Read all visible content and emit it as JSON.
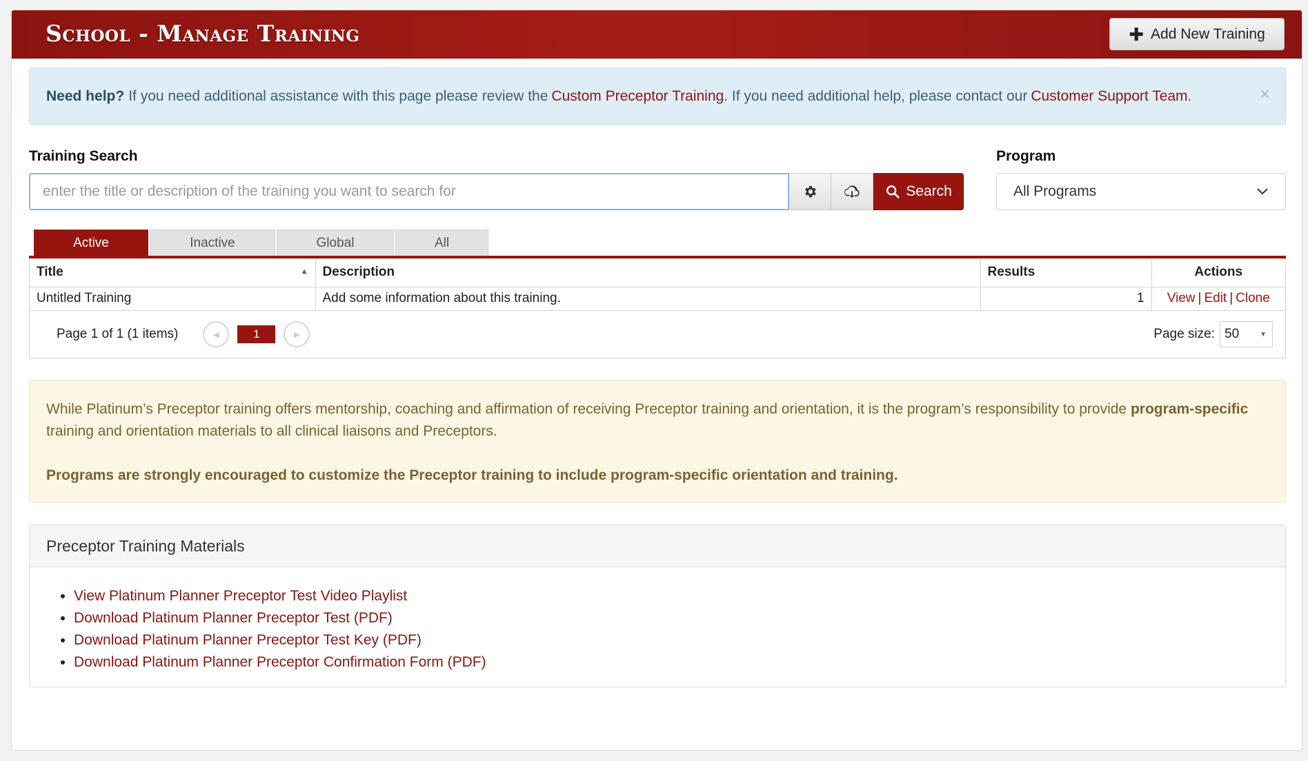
{
  "header": {
    "title": "School - Manage Training",
    "add_button": "Add New Training"
  },
  "help": {
    "lead": "Need help?",
    "text1": "If you need additional assistance with this page please review the",
    "link1": "Custom Preceptor Training",
    "text2": ". If you need additional help, please contact our",
    "link2": "Customer Support Team",
    "text3": ".",
    "close": "×"
  },
  "search": {
    "label": "Training Search",
    "placeholder": "enter the title or description of the training you want to search for",
    "button": "Search"
  },
  "program": {
    "label": "Program",
    "selected": "All Programs"
  },
  "tabs": [
    "Active",
    "Inactive",
    "Global",
    "All"
  ],
  "grid": {
    "columns": [
      "Title",
      "Description",
      "Results",
      "Actions"
    ],
    "rows": [
      {
        "title": "Untitled Training",
        "description": "Add some information about this training.",
        "results": "1"
      }
    ],
    "actions": [
      "View",
      "Edit",
      "Clone"
    ],
    "pager_info": "Page 1 of 1 (1 items)",
    "current_page": "1",
    "page_size_label": "Page size:",
    "page_size": "50"
  },
  "notice": {
    "text1": "While Platinum’s Preceptor training offers mentorship, coaching and affirmation of receiving Preceptor training and orientation, it is the program’s responsibility to provide",
    "bold": "program-specific",
    "text2": "training and orientation materials to all clinical liaisons and Preceptors.",
    "strong_line": "Programs are strongly encouraged to customize the Preceptor training to include program-specific orientation and training."
  },
  "materials": {
    "title": "Preceptor Training Materials",
    "links": [
      "View Platinum Planner Preceptor Test Video Playlist",
      "Download Platinum Planner Preceptor Test (PDF)",
      "Download Platinum Planner Preceptor Test Key (PDF)",
      "Download Platinum Planner Preceptor Confirmation Form (PDF)"
    ]
  },
  "colors": {
    "brand": "#98150f",
    "help_bg": "#dfedf6",
    "notice_bg": "#fbf7e4"
  },
  "icons": [
    "plus-icon",
    "gear-icon",
    "cloud-download-icon",
    "search-icon",
    "chevron-down-icon",
    "sort-asc-icon",
    "prev-page-icon",
    "next-page-icon",
    "close-icon"
  ]
}
